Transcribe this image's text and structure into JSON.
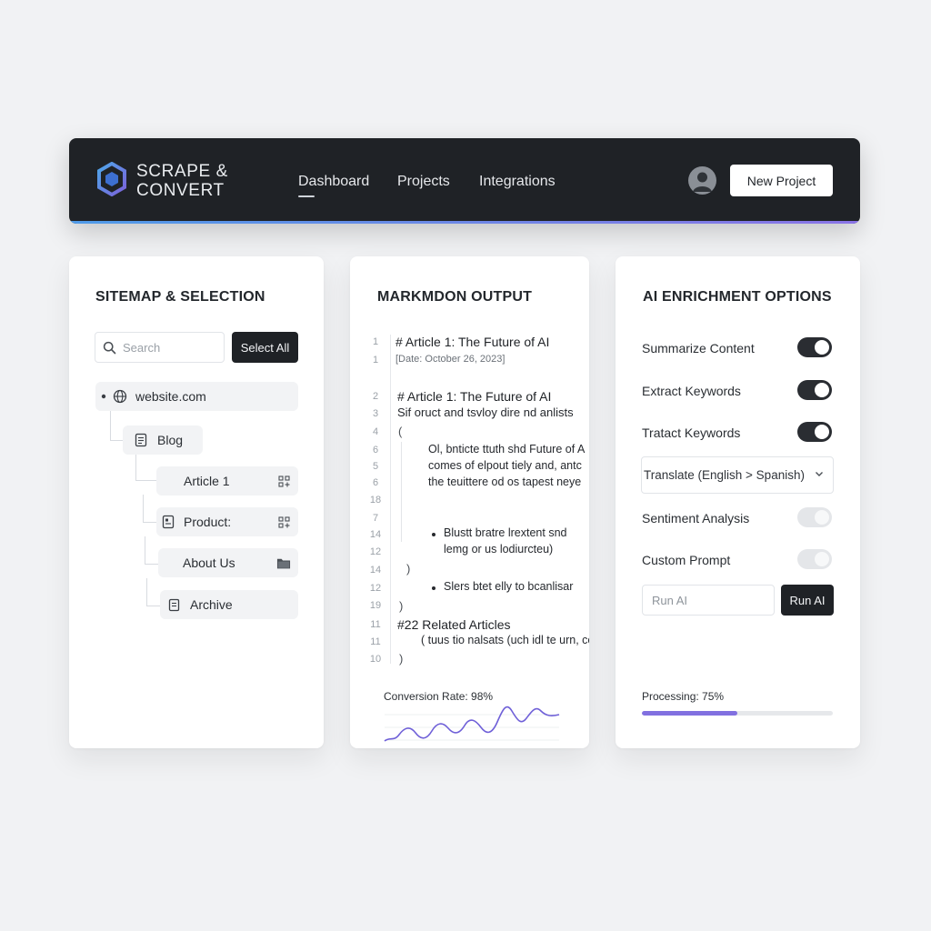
{
  "header": {
    "brand_line1": "SCRAPE &",
    "brand_line2": "CONVERT",
    "nav": [
      "Dashboard",
      "Projects",
      "Integrations"
    ],
    "active_nav": "Dashboard",
    "new_project_label": "New Project"
  },
  "sitemap": {
    "title": "SITEMAP & SELECTION",
    "search_placeholder": "Search",
    "select_all_label": "Select All",
    "root": "website.com",
    "items": [
      "Blog",
      "Article 1",
      "Product:",
      "About Us",
      "Archive"
    ]
  },
  "markdown": {
    "title": "MARKMDON OUTPUT",
    "lines": [
      {
        "num": "1",
        "text": "# Article 1: The Future of AI"
      },
      {
        "num": "1",
        "text": "[Date: October 26, 2023]"
      },
      {
        "num": "2",
        "text": "# Article 1: The Future of AI"
      },
      {
        "num": "3",
        "text": "Sif oruct and tsvloy dire nd anlists"
      },
      {
        "num": "4",
        "text": "("
      },
      {
        "num": "6",
        "text": "Ol, bnticte ttuth shd Future of A"
      },
      {
        "num": "5",
        "text": "comes of elpout tiely and, antc"
      },
      {
        "num": "6",
        "text": "the teuittere od os tapest neye"
      },
      {
        "num": "18",
        "text": ""
      },
      {
        "num": "7",
        "text": ""
      },
      {
        "num": "14",
        "text": "Blustt bratre lrextent snd"
      },
      {
        "num": "12",
        "text": "lemg or us lodiurcteu)"
      },
      {
        "num": "14",
        "text": ")"
      },
      {
        "num": "12",
        "text": "Slers btet elly to bcanlisar"
      },
      {
        "num": "19",
        "text": ")"
      },
      {
        "num": "11",
        "text": "#22 Related Articles"
      },
      {
        "num": "11",
        "text": "( tuus tio nalsats (uch idl te urn, ce"
      },
      {
        "num": "10",
        "text": ")"
      }
    ],
    "conversion_label": "Conversion Rate: 98%"
  },
  "ai": {
    "title": "AI ENRICHMENT OPTIONS",
    "options": [
      {
        "label": "Summarize Content",
        "on": true
      },
      {
        "label": "Extract Keywords",
        "on": true
      },
      {
        "label": "Tratact Keywords",
        "on": true
      },
      {
        "label": "Sentiment Analysis",
        "on": false
      },
      {
        "label": "Custom Prompt",
        "on": false
      }
    ],
    "translate_value": "Translate (English > Spanish)",
    "prompt_placeholder": "Run AI",
    "run_label": "Run AI",
    "processing_label": "Processing: 75%",
    "progress": 0.5
  },
  "colors": {
    "accent": "#8170e0",
    "header_bg": "#1f2226"
  }
}
